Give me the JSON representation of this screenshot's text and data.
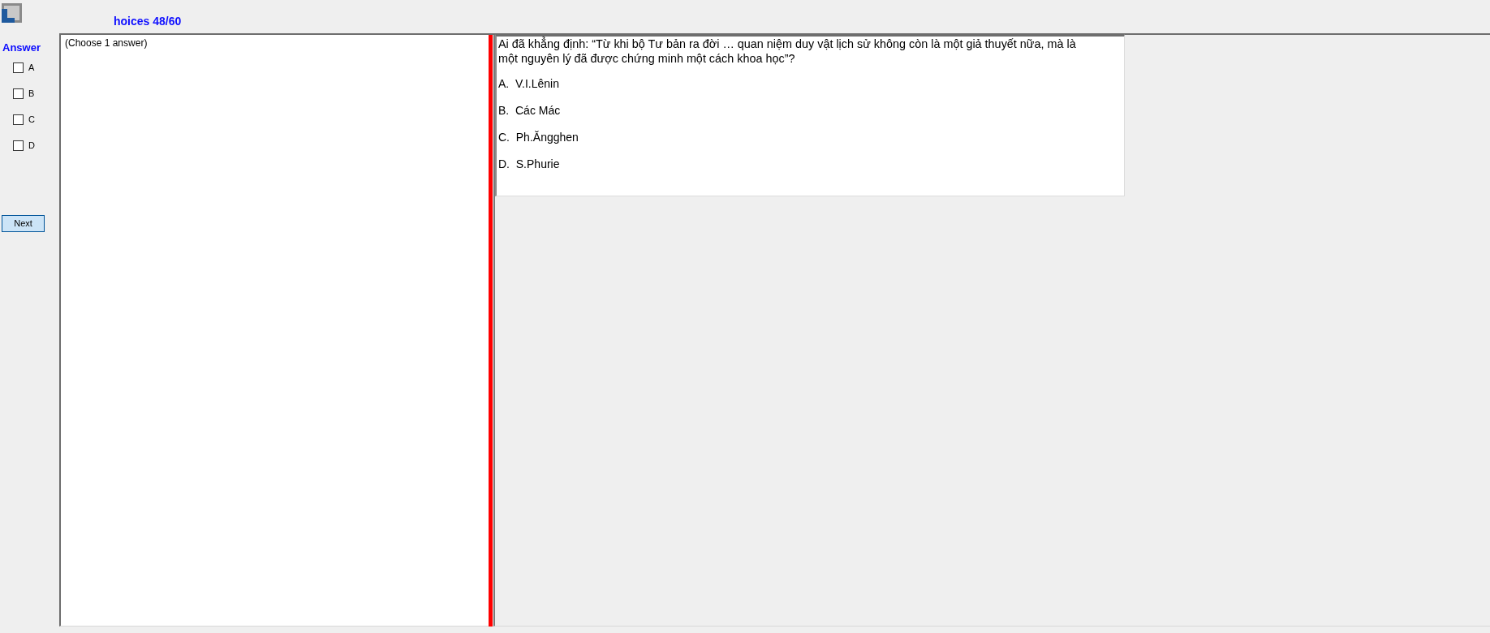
{
  "window": {
    "title": "hoices 48/60"
  },
  "answer_panel": {
    "heading": "Answer",
    "options": [
      {
        "label": "A",
        "checked": false
      },
      {
        "label": "B",
        "checked": false
      },
      {
        "label": "C",
        "checked": false
      },
      {
        "label": "D",
        "checked": false
      }
    ],
    "next_button": "Next"
  },
  "instruction": "(Choose 1 answer)",
  "question": {
    "text": "Ai đã khẳng định: “Từ khi bộ Tư bản ra đời … quan niệm duy vật lịch sử không còn là một giả thuyết nữa, mà là một nguyên lý đã được chứng minh một cách khoa học”?",
    "options": [
      "A.  V.I.Lênin",
      "B.  Các Mác",
      "C.  Ph.Ăngghen",
      "D.  S.Phurie"
    ]
  }
}
